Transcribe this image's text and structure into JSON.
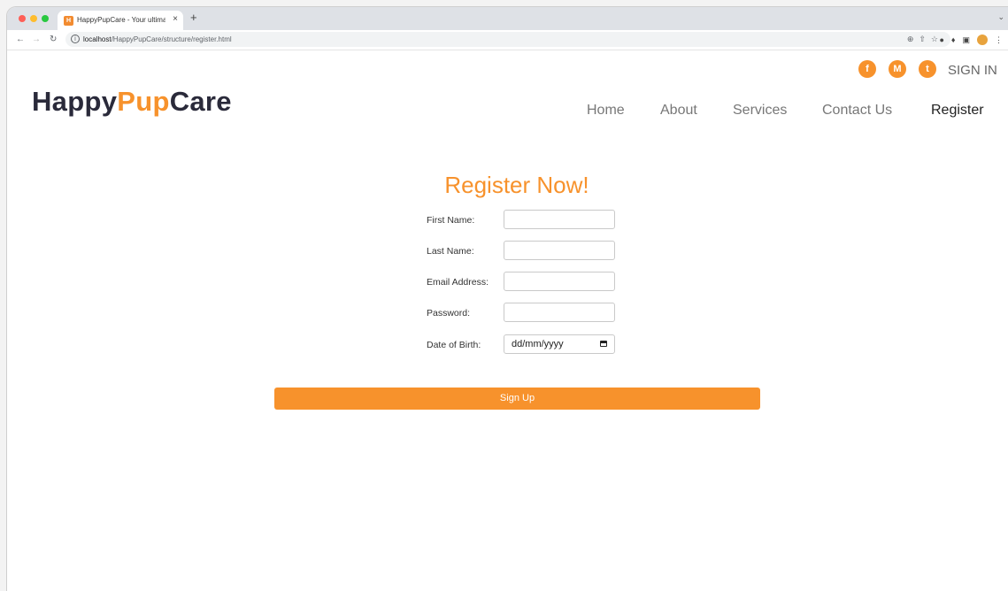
{
  "browser": {
    "tab_title": "HappyPupCare - Your ultimate",
    "tab_close": "×",
    "new_tab": "+",
    "tab_favicon": "H",
    "url_host": "localhost",
    "url_path": "/HappyPupCare/structure/register.html",
    "back_icon": "back-arrow-icon",
    "forward_icon": "forward-arrow-icon",
    "reload_icon": "reload-icon"
  },
  "header": {
    "logo_part1": "Happy",
    "logo_part2": "Pup",
    "logo_part3": "Care",
    "social": [
      {
        "name": "facebook-icon",
        "glyph": "f"
      },
      {
        "name": "gmail-icon",
        "glyph": "M"
      },
      {
        "name": "twitter-icon",
        "glyph": "t"
      }
    ],
    "sign_in": "SIGN IN",
    "nav": [
      "Home",
      "About",
      "Services",
      "Contact Us",
      "Register"
    ],
    "active_nav": "Register"
  },
  "form": {
    "title": "Register Now!",
    "fields": [
      {
        "label": "First Name:",
        "value": ""
      },
      {
        "label": "Last Name:",
        "value": ""
      },
      {
        "label": "Email Address:",
        "value": ""
      },
      {
        "label": "Password:",
        "value": ""
      },
      {
        "label": "Date of Birth:",
        "placeholder": "dd/mm/yyyy"
      }
    ],
    "submit_label": "Sign Up"
  },
  "colors": {
    "accent": "#f7922c",
    "logo_dark": "#2a2a3a",
    "nav_text": "#777777",
    "nav_active": "#222222"
  }
}
